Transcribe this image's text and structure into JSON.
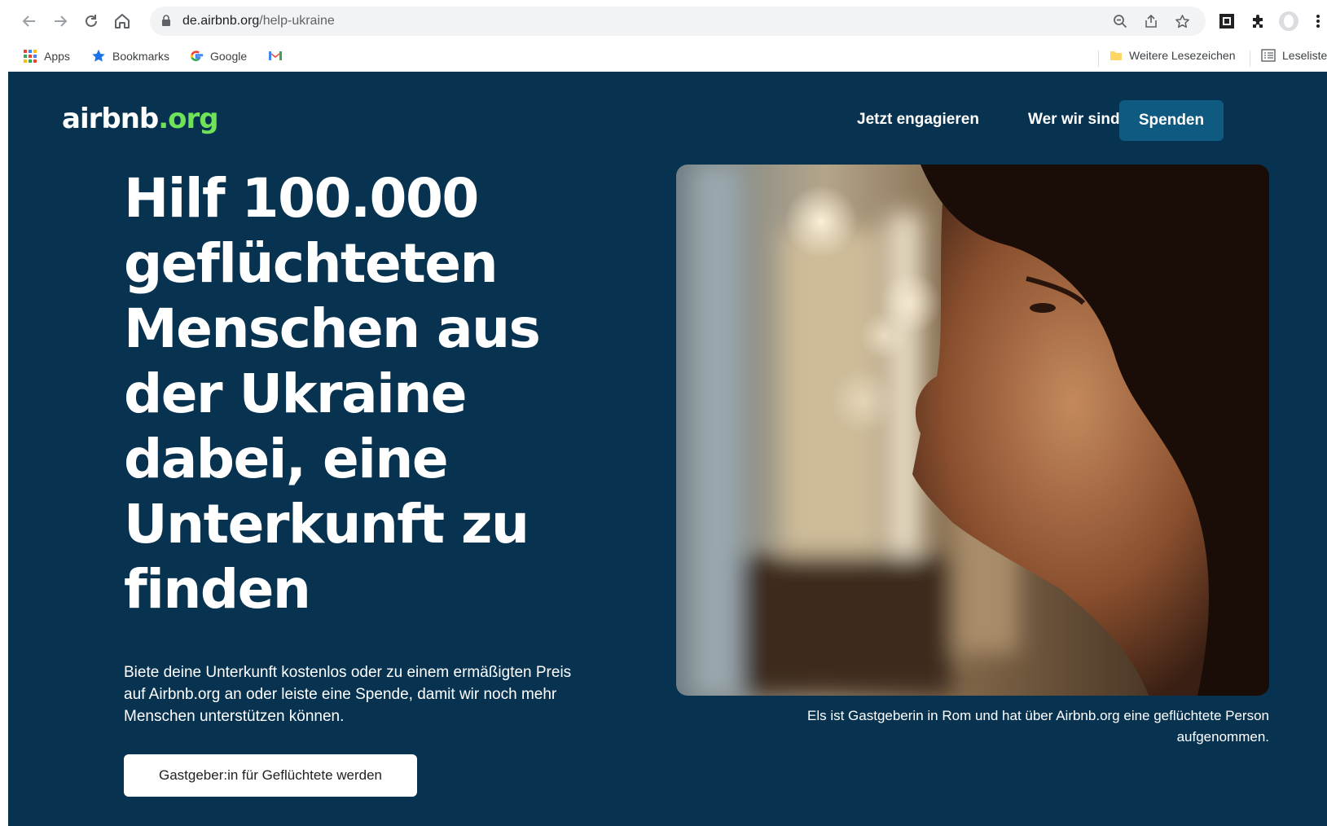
{
  "browser": {
    "url_host": "de.airbnb.org",
    "url_path": "/help-ukraine",
    "bookmarks": {
      "apps": "Apps",
      "bookmarks": "Bookmarks",
      "google": "Google",
      "more": "Weitere Lesezeichen",
      "reading_list": "Leseliste"
    }
  },
  "site": {
    "logo_main": "airbnb",
    "logo_org": ".org",
    "nav": {
      "engage": "Jetzt engagieren",
      "about": "Wer wir sind",
      "donate": "Spenden"
    }
  },
  "hero": {
    "headline": "Hilf 100.000 geflüchteten Menschen aus der Ukraine dabei, eine Unterkunft zu finden",
    "lead": "Biete deine Unterkunft kostenlos oder zu einem ermäßigten Preis auf Airbnb.org an oder leiste eine Spende, damit wir noch mehr Menschen unterstützen können.",
    "cta": "Gastgeber:in für Geflüchtete werden",
    "caption": "Els ist Gastgeberin in Rom und hat über Airbnb.org eine geflüchtete Person aufgenommen."
  },
  "colors": {
    "page_background": "#083350",
    "logo_accent": "#6fe25a",
    "donate_button": "#0f5a80"
  },
  "icons": [
    "back-arrow-icon",
    "forward-arrow-icon",
    "reload-icon",
    "home-icon",
    "lock-icon",
    "zoom-icon",
    "share-icon",
    "star-icon",
    "extension-icon",
    "puzzle-icon",
    "profile-avatar-icon",
    "menu-dots-icon",
    "apps-grid-icon",
    "bookmark-star-icon",
    "google-g-icon",
    "gmail-icon",
    "folder-icon",
    "reading-list-icon"
  ]
}
